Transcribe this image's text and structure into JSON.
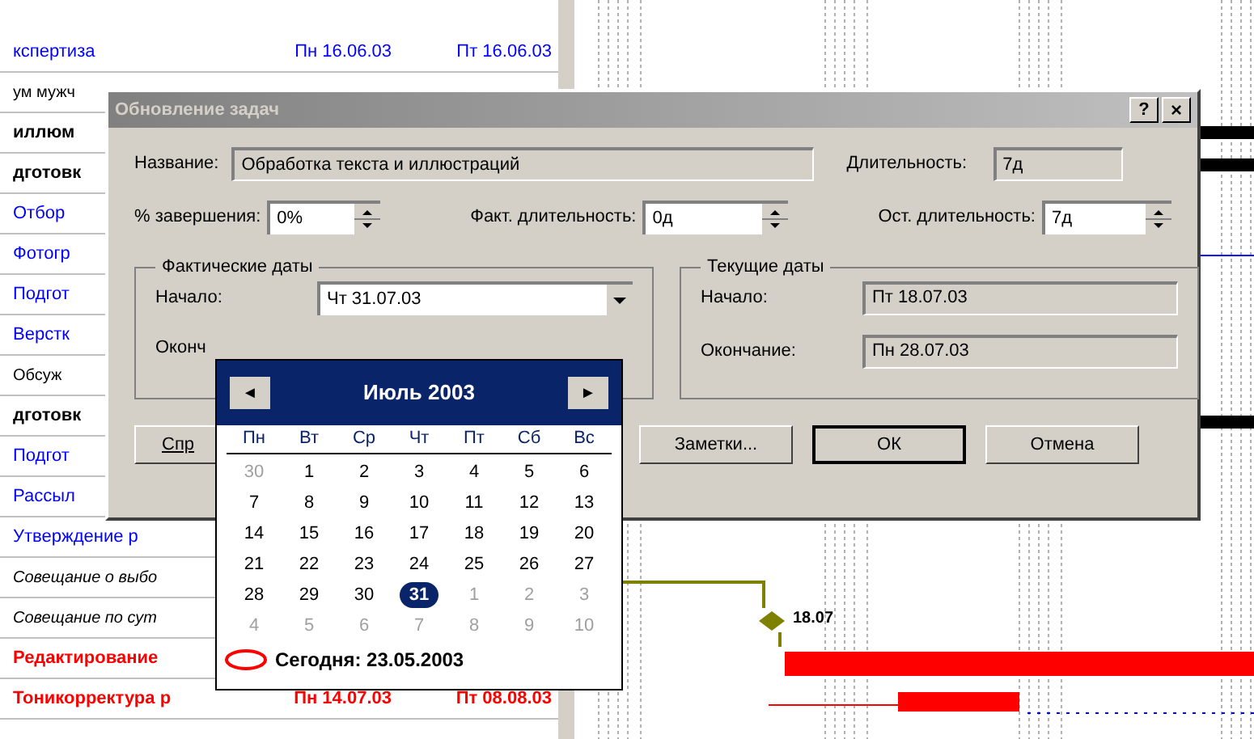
{
  "tasks": [
    {
      "name": "кспертиза",
      "kind": "blue",
      "start": "Пн 16.06.03",
      "finish": "Пт 16.06.03"
    },
    {
      "name": "ум мужч",
      "kind": "plain"
    },
    {
      "name": "иллюм",
      "kind": "bold"
    },
    {
      "name": "дготовк",
      "kind": "bold"
    },
    {
      "name": "Отбор",
      "kind": "blue"
    },
    {
      "name": "Фотогр",
      "kind": "blue"
    },
    {
      "name": "Подгот",
      "kind": "blue"
    },
    {
      "name": "Верстк",
      "kind": "blue"
    },
    {
      "name": "Обсуж",
      "kind": "plain"
    },
    {
      "name": "дготовк",
      "kind": "bold"
    },
    {
      "name": "Подгот",
      "kind": "blue"
    },
    {
      "name": "Рассыл",
      "kind": "blue"
    },
    {
      "name": "Утверждение р",
      "kind": "blue"
    },
    {
      "name": "Совещание о выбо",
      "kind": "italic"
    },
    {
      "name": "Совещание по сут",
      "kind": "italic"
    },
    {
      "name": "Редактирование",
      "kind": "red"
    },
    {
      "name": "Тоникорректура р",
      "kind": "red",
      "start": "Пн 14.07.03",
      "finish": "Пт 08.08.03"
    }
  ],
  "gantt": {
    "milestone_label": "18.07"
  },
  "dialog": {
    "title": "Обновление задач",
    "help_button": "?",
    "close_button": "×",
    "name_label": "Название:",
    "name_value": "Обработка текста и иллюстраций",
    "duration_label": "Длительность:",
    "duration_value": "7д",
    "spins": [
      {
        "label": "% завершения:",
        "value": "0%"
      },
      {
        "label": "Факт. длительность:",
        "value": "0д"
      },
      {
        "label": "Ост. длительность:",
        "value": "7д"
      }
    ],
    "actual_group": {
      "title": "Фактические даты",
      "start_label": "Начало:",
      "start_value": "Чт 31.07.03",
      "finish_label": "Оконч"
    },
    "current_group": {
      "title": "Текущие даты",
      "start_label": "Начало:",
      "start_value": "Пт 18.07.03",
      "finish_label": "Окончание:",
      "finish_value": "Пн 28.07.03"
    },
    "buttons": [
      {
        "label": "Спр",
        "default": false
      },
      {
        "label": "Заметки...",
        "default": false
      },
      {
        "label": "ОК",
        "default": true
      },
      {
        "label": "Отмена",
        "default": false
      }
    ]
  },
  "calendar": {
    "month": "Июль 2003",
    "prev": "◄",
    "next": "►",
    "weekdays": [
      "Пн",
      "Вт",
      "Ср",
      "Чт",
      "Пт",
      "Сб",
      "Вс"
    ],
    "days": [
      {
        "day": "30",
        "other_month": true,
        "selected": false
      },
      {
        "day": "1",
        "other_month": false,
        "selected": false
      },
      {
        "day": "2",
        "other_month": false,
        "selected": false
      },
      {
        "day": "3",
        "other_month": false,
        "selected": false
      },
      {
        "day": "4",
        "other_month": false,
        "selected": false
      },
      {
        "day": "5",
        "other_month": false,
        "selected": false
      },
      {
        "day": "6",
        "other_month": false,
        "selected": false
      },
      {
        "day": "7",
        "other_month": false,
        "selected": false
      },
      {
        "day": "8",
        "other_month": false,
        "selected": false
      },
      {
        "day": "9",
        "other_month": false,
        "selected": false
      },
      {
        "day": "10",
        "other_month": false,
        "selected": false
      },
      {
        "day": "11",
        "other_month": false,
        "selected": false
      },
      {
        "day": "12",
        "other_month": false,
        "selected": false
      },
      {
        "day": "13",
        "other_month": false,
        "selected": false
      },
      {
        "day": "14",
        "other_month": false,
        "selected": false
      },
      {
        "day": "15",
        "other_month": false,
        "selected": false
      },
      {
        "day": "16",
        "other_month": false,
        "selected": false
      },
      {
        "day": "17",
        "other_month": false,
        "selected": false
      },
      {
        "day": "18",
        "other_month": false,
        "selected": false
      },
      {
        "day": "19",
        "other_month": false,
        "selected": false
      },
      {
        "day": "20",
        "other_month": false,
        "selected": false
      },
      {
        "day": "21",
        "other_month": false,
        "selected": false
      },
      {
        "day": "22",
        "other_month": false,
        "selected": false
      },
      {
        "day": "23",
        "other_month": false,
        "selected": false
      },
      {
        "day": "24",
        "other_month": false,
        "selected": false
      },
      {
        "day": "25",
        "other_month": false,
        "selected": false
      },
      {
        "day": "26",
        "other_month": false,
        "selected": false
      },
      {
        "day": "27",
        "other_month": false,
        "selected": false
      },
      {
        "day": "28",
        "other_month": false,
        "selected": false
      },
      {
        "day": "29",
        "other_month": false,
        "selected": false
      },
      {
        "day": "30",
        "other_month": false,
        "selected": false
      },
      {
        "day": "31",
        "other_month": false,
        "selected": true
      },
      {
        "day": "1",
        "other_month": true,
        "selected": false
      },
      {
        "day": "2",
        "other_month": true,
        "selected": false
      },
      {
        "day": "3",
        "other_month": true,
        "selected": false
      },
      {
        "day": "4",
        "other_month": true,
        "selected": false
      },
      {
        "day": "5",
        "other_month": true,
        "selected": false
      },
      {
        "day": "6",
        "other_month": true,
        "selected": false
      },
      {
        "day": "7",
        "other_month": true,
        "selected": false
      },
      {
        "day": "8",
        "other_month": true,
        "selected": false
      },
      {
        "day": "9",
        "other_month": true,
        "selected": false
      },
      {
        "day": "10",
        "other_month": true,
        "selected": false
      }
    ],
    "today": "Сегодня: 23.05.2003"
  }
}
